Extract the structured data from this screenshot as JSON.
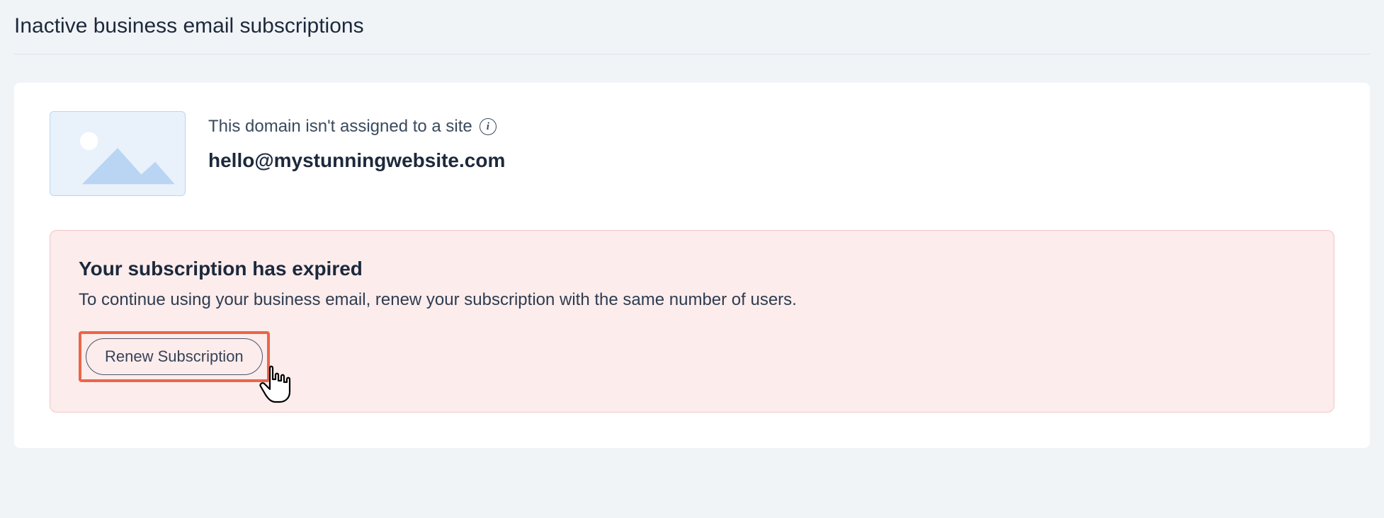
{
  "page": {
    "title": "Inactive business email subscriptions"
  },
  "domain": {
    "not_assigned_text": "This domain isn't assigned to a site",
    "email": "hello@mystunningwebsite.com"
  },
  "alert": {
    "title": "Your subscription has expired",
    "description": "To continue using your business email, renew your subscription with the same number of users.",
    "renew_label": "Renew Subscription"
  }
}
